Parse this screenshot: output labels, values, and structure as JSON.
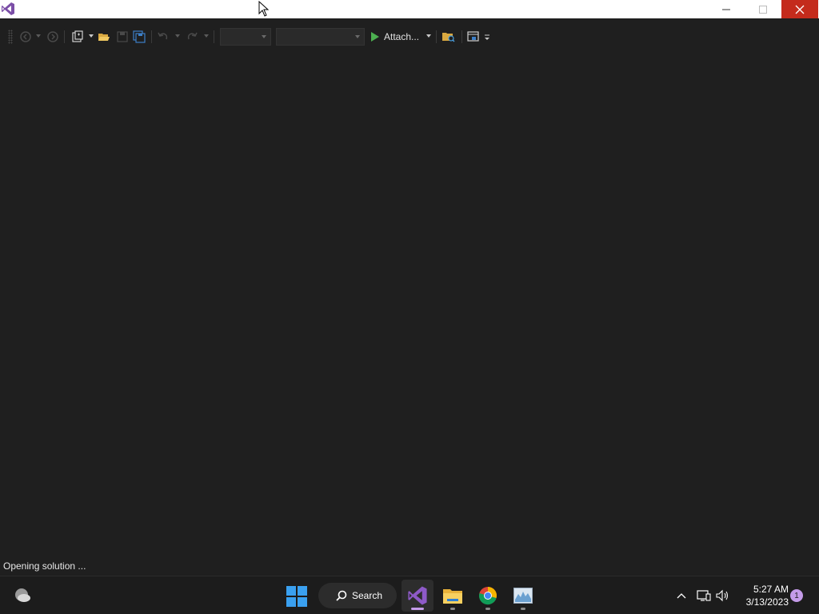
{
  "window": {
    "app_icon": "visual-studio-icon",
    "controls": {
      "minimize": "minimize-icon",
      "maximize": "maximize-icon",
      "close": "close-icon"
    }
  },
  "toolbar": {
    "attach_label": "Attach...",
    "combo1_value": "",
    "combo2_value": ""
  },
  "status": {
    "text": "Opening solution ..."
  },
  "taskbar": {
    "search_label": "Search",
    "time": "5:27 AM",
    "date": "3/13/2023",
    "notification_count": "1",
    "pinned_apps": [
      "visual-studio",
      "file-explorer",
      "chrome",
      "resource-monitor"
    ]
  },
  "colors": {
    "accent": "#c49be8",
    "close": "#c42b1c",
    "play": "#4caf50"
  }
}
